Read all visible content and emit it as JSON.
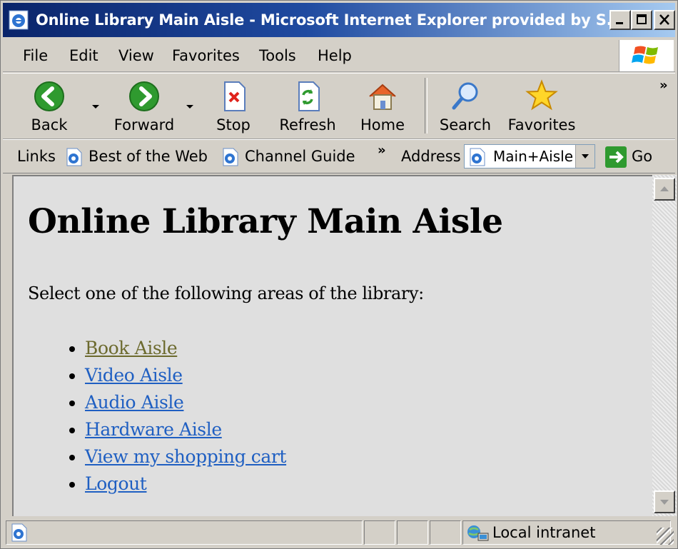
{
  "window": {
    "title": "Online Library Main Aisle - Microsoft Internet Explorer provided by S..."
  },
  "menu": {
    "items": [
      "File",
      "Edit",
      "View",
      "Favorites",
      "Tools",
      "Help"
    ]
  },
  "toolbar": {
    "back": "Back",
    "forward": "Forward",
    "stop": "Stop",
    "refresh": "Refresh",
    "home": "Home",
    "search": "Search",
    "favorites": "Favorites",
    "more": "»"
  },
  "links_bar": {
    "label": "Links",
    "items": [
      "Best of the Web",
      "Channel Guide"
    ],
    "more": "»",
    "address_label": "Address",
    "address_value": "Main+Aisle",
    "go_label": "Go"
  },
  "page": {
    "heading": "Online Library Main Aisle",
    "intro": "Select one of the following areas of the library:",
    "links": [
      "Book Aisle",
      "Video Aisle",
      "Audio Aisle",
      "Hardware Aisle",
      "View my shopping cart",
      "Logout"
    ]
  },
  "statusbar": {
    "zone": "Local intranet"
  },
  "colors": {
    "title_bar": "#0a246a",
    "link": "#1f5fc2",
    "visited_link": "#6c6a2e",
    "content_bg": "#dfdfdf"
  }
}
